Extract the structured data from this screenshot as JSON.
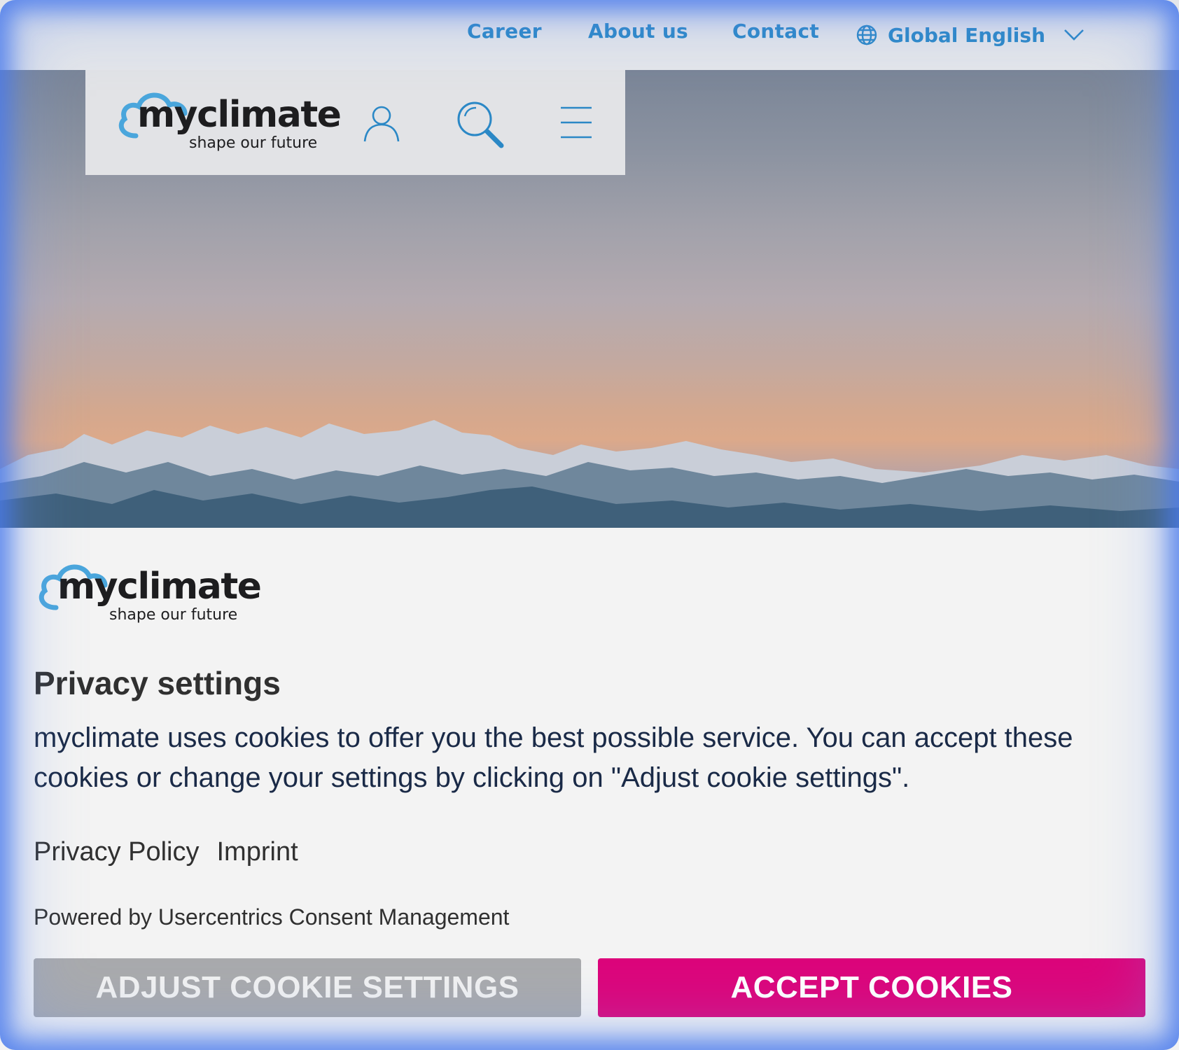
{
  "top_nav": {
    "career": "Career",
    "about": "About us",
    "contact": "Contact",
    "language": "Global English",
    "icons": {
      "globe": "globe-icon",
      "chevron": "chevron-down-icon"
    }
  },
  "header": {
    "logo": {
      "wordmark": "myclimate",
      "tagline": "shape our future"
    },
    "icons": [
      "user-icon",
      "search-icon",
      "menu-icon"
    ]
  },
  "cookie_modal": {
    "logo": {
      "wordmark": "myclimate",
      "tagline": "shape our future"
    },
    "title": "Privacy settings",
    "body": "myclimate uses cookies to offer you the best possible service. You can accept these cookies or change your settings by clicking on \"Adjust cookie settings\".",
    "links": {
      "privacy_policy": "Privacy Policy",
      "imprint": "Imprint"
    },
    "powered_by": "Powered by Usercentrics Consent Management",
    "buttons": {
      "adjust": "Adjust cookie settings",
      "accept": "Accept cookies"
    }
  },
  "colors": {
    "accent_blue": "#2b88c6",
    "accept_button": "#dc057b",
    "adjust_button": "#a9aaad",
    "logo_cloud": "#4aa6dc"
  }
}
